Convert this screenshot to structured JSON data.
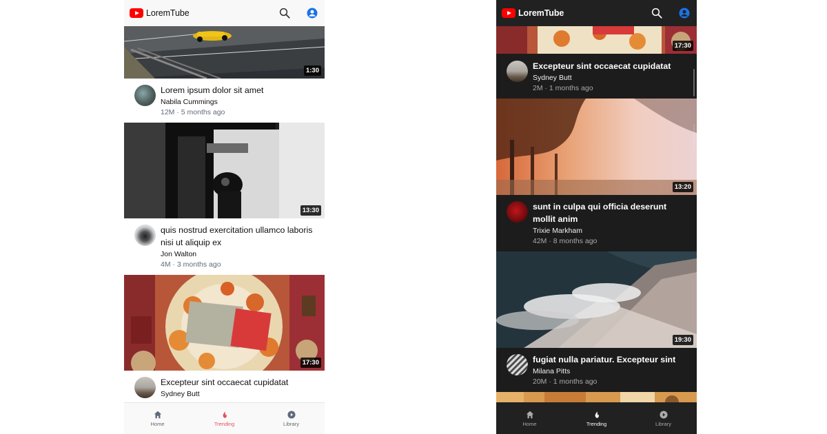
{
  "app": {
    "name": "LoremTube"
  },
  "icons": {
    "search": "search-icon",
    "account": "account-circle-icon"
  },
  "colors": {
    "brand_red": "#ff0000",
    "active_light": "#e74c5c",
    "account_blue": "#1a73e8"
  },
  "light_view": {
    "videos": [
      {
        "title": "",
        "channel": "",
        "stats": "",
        "duration": "1:30"
      },
      {
        "title": "Lorem ipsum dolor sit amet",
        "channel": "Nabila Cummings",
        "stats": "12M · 5 months ago",
        "duration": "13:30"
      },
      {
        "title": "quis nostrud exercitation ullamco laboris nisi ut aliquip ex",
        "channel": "Jon Walton",
        "stats": "4M · 3 months ago",
        "duration": "17:30"
      },
      {
        "title": "Excepteur sint occaecat cupidatat",
        "channel": "Sydney Butt",
        "stats": ""
      }
    ]
  },
  "dark_view": {
    "videos": [
      {
        "title": "",
        "channel": "",
        "stats": "",
        "duration": "17:30"
      },
      {
        "title": "Excepteur sint occaecat cupidatat",
        "channel": "Sydney Butt",
        "stats": "2M · 1 months ago",
        "duration": "13:20"
      },
      {
        "title": "sunt in culpa qui officia deserunt mollit anim",
        "channel": "Trixie Markham",
        "stats": "42M · 8 months ago",
        "duration": "19:30"
      },
      {
        "title": "fugiat nulla pariatur. Excepteur sint",
        "channel": "Milana Pitts",
        "stats": "20M · 1 months ago"
      }
    ]
  },
  "nav": {
    "items": [
      {
        "label": "Home",
        "icon": "home-icon"
      },
      {
        "label": "Trending",
        "icon": "flame-icon"
      },
      {
        "label": "Library",
        "icon": "library-play-icon"
      }
    ],
    "light_active": "Trending",
    "dark_active": "Trending"
  }
}
